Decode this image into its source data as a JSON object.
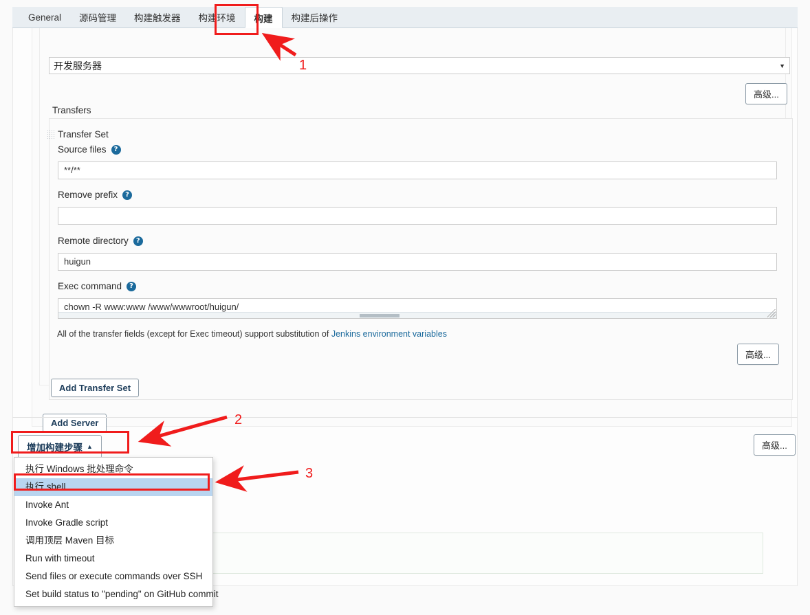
{
  "tabs": [
    {
      "label": "General",
      "active": false
    },
    {
      "label": "源码管理",
      "active": false
    },
    {
      "label": "构建触发器",
      "active": false
    },
    {
      "label": "构建环境",
      "active": false
    },
    {
      "label": "构建",
      "active": true
    },
    {
      "label": "构建后操作",
      "active": false
    }
  ],
  "server": {
    "selected": "开发服务器",
    "caret": "▼"
  },
  "buttons": {
    "advanced": "高级...",
    "add_transfer_set": "Add Transfer Set",
    "add_server": "Add Server",
    "add_build_step": "增加构建步骤",
    "add_build_step_caret": "▲"
  },
  "transfers": {
    "section_label": "Transfers",
    "transfer_set_label": "Transfer Set",
    "help_glyph": "?",
    "fields": [
      {
        "label": "Source files",
        "value": "**/**"
      },
      {
        "label": "Remove prefix",
        "value": ""
      },
      {
        "label": "Remote directory",
        "value": "huigun"
      },
      {
        "label": "Exec command",
        "value": "chown -R www:www /www/wwwroot/huigun/"
      }
    ],
    "hint_prefix": "All of the transfer fields (except for Exec timeout) support substitution of ",
    "hint_link": "Jenkins environment variables"
  },
  "menu": {
    "items": [
      {
        "label": "执行 Windows 批处理命令",
        "selected": false
      },
      {
        "label": "执行 shell",
        "selected": true
      },
      {
        "label": "Invoke Ant",
        "selected": false
      },
      {
        "label": "Invoke Gradle script",
        "selected": false
      },
      {
        "label": "调用顶层 Maven 目标",
        "selected": false
      },
      {
        "label": "Run with timeout",
        "selected": false
      },
      {
        "label": "Send files or execute commands over SSH",
        "selected": false
      },
      {
        "label": "Set build status to \"pending\" on GitHub commit",
        "selected": false
      }
    ]
  },
  "annotations": {
    "color": "#f01c1c",
    "steps": [
      {
        "number": "1",
        "target": "构建 tab"
      },
      {
        "number": "2",
        "target": "增加构建步骤 button"
      },
      {
        "number": "3",
        "target": "执行 shell menu item"
      }
    ]
  }
}
